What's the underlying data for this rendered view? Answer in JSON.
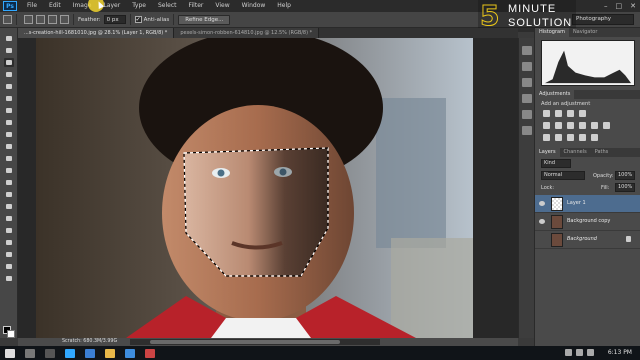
{
  "menubar": {
    "app_badge": "Ps",
    "items": [
      "File",
      "Edit",
      "Image",
      "Layer",
      "Type",
      "Select",
      "Filter",
      "View",
      "Window",
      "Help"
    ]
  },
  "window_controls": {
    "minimize": "–",
    "maximize": "□",
    "close": "✕"
  },
  "options": {
    "feather_label": "Feather:",
    "feather_value": "0 px",
    "antialias_label": "Anti-alias",
    "refine_edge_label": "Refine Edge...",
    "workspace": "Photography"
  },
  "brand": {
    "number": "5",
    "line1": "MINUTE",
    "line2": "SOLUTION",
    "color": "#e8c51a"
  },
  "documents": {
    "tabs": [
      "...s-creation-hill-1681010.jpg @ 28.1% (Layer 1, RGB/8) *",
      "pexels-simon-robben-614810.jpg @ 12.5% (RGB/8) *"
    ],
    "active_index": 0
  },
  "status": {
    "scratch": "Scratch: 680.3M/3.99G"
  },
  "histogram_panel": {
    "tabs": [
      "Histogram",
      "Navigator"
    ]
  },
  "adjustments_panel": {
    "tab": "Adjustments",
    "title": "Add an adjustment"
  },
  "layers_panel": {
    "tabs": [
      "Layers",
      "Channels",
      "Paths"
    ],
    "kind_label": "Kind",
    "blend_mode": "Normal",
    "opacity_label": "Opacity:",
    "opacity_value": "100%",
    "lock_label": "Lock:",
    "fill_label": "Fill:",
    "fill_value": "100%",
    "layers": [
      {
        "name": "Layer 1",
        "selected": true,
        "visible": true,
        "locked": false
      },
      {
        "name": "Background copy",
        "selected": false,
        "visible": true,
        "locked": false
      },
      {
        "name": "Background",
        "selected": false,
        "visible": false,
        "locked": true
      }
    ]
  },
  "taskbar": {
    "time": "6:13 PM"
  },
  "colors": {
    "selection": "#4d6c8f",
    "jacket": "#b8222a",
    "accent_blue": "#31a8ff"
  }
}
